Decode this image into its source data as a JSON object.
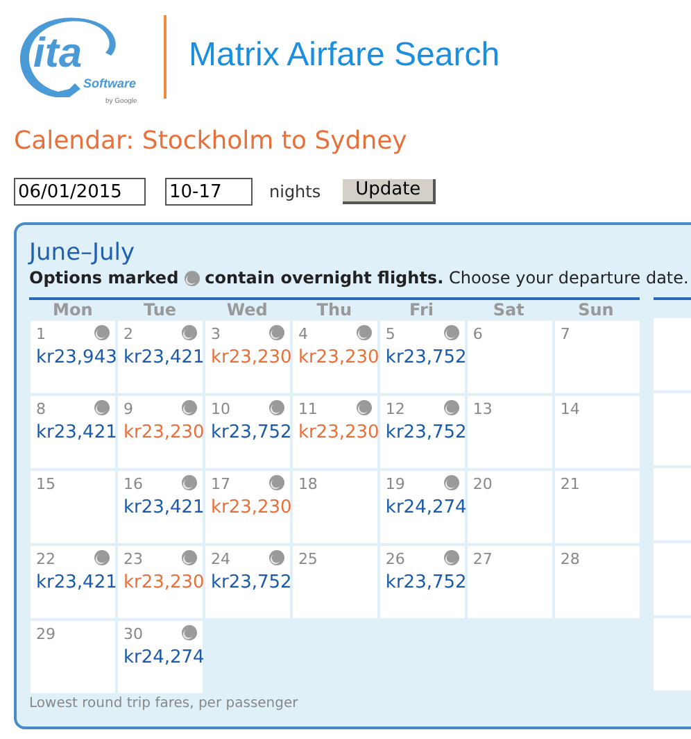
{
  "logo": {
    "mark": "ita",
    "software": "Software",
    "by": "by Google"
  },
  "app_title": "Matrix Airfare Search",
  "heading": "Calendar: Stockholm to Sydney",
  "form": {
    "date": "06/01/2015",
    "nights": "10-17",
    "nights_label": "nights",
    "button": "Update"
  },
  "calendar": {
    "month": "June–July",
    "note_bold_start": "Options marked",
    "note_bold_end": "contain overnight flights.",
    "note_rest": "Choose your departure date.",
    "weekdays": [
      "Mon",
      "Tue",
      "Wed",
      "Thu",
      "Fri",
      "Sat",
      "Sun"
    ],
    "weeks": [
      [
        {
          "day": "1",
          "fare": "kr23,943",
          "overnight": true,
          "lowest": false
        },
        {
          "day": "2",
          "fare": "kr23,421",
          "overnight": true,
          "lowest": false
        },
        {
          "day": "3",
          "fare": "kr23,230",
          "overnight": true,
          "lowest": true
        },
        {
          "day": "4",
          "fare": "kr23,230",
          "overnight": true,
          "lowest": true
        },
        {
          "day": "5",
          "fare": "kr23,752",
          "overnight": true,
          "lowest": false
        },
        {
          "day": "6"
        },
        {
          "day": "7"
        }
      ],
      [
        {
          "day": "8",
          "fare": "kr23,421",
          "overnight": true,
          "lowest": false
        },
        {
          "day": "9",
          "fare": "kr23,230",
          "overnight": true,
          "lowest": true
        },
        {
          "day": "10",
          "fare": "kr23,752",
          "overnight": true,
          "lowest": false
        },
        {
          "day": "11",
          "fare": "kr23,230",
          "overnight": true,
          "lowest": true
        },
        {
          "day": "12",
          "fare": "kr23,752",
          "overnight": true,
          "lowest": false
        },
        {
          "day": "13"
        },
        {
          "day": "14"
        }
      ],
      [
        {
          "day": "15"
        },
        {
          "day": "16",
          "fare": "kr23,421",
          "overnight": true,
          "lowest": false
        },
        {
          "day": "17",
          "fare": "kr23,230",
          "overnight": true,
          "lowest": true
        },
        {
          "day": "18"
        },
        {
          "day": "19",
          "fare": "kr24,274",
          "overnight": true,
          "lowest": false
        },
        {
          "day": "20"
        },
        {
          "day": "21"
        }
      ],
      [
        {
          "day": "22",
          "fare": "kr23,421",
          "overnight": true,
          "lowest": false
        },
        {
          "day": "23",
          "fare": "kr23,230",
          "overnight": true,
          "lowest": true
        },
        {
          "day": "24",
          "fare": "kr23,752",
          "overnight": true,
          "lowest": false
        },
        {
          "day": "25"
        },
        {
          "day": "26",
          "fare": "kr23,752",
          "overnight": true,
          "lowest": false
        },
        {
          "day": "27"
        },
        {
          "day": "28"
        }
      ],
      [
        {
          "day": "29"
        },
        {
          "day": "30",
          "fare": "kr24,274",
          "overnight": true,
          "lowest": false
        }
      ]
    ],
    "footnote": "Lowest round trip fares, per passenger"
  }
}
